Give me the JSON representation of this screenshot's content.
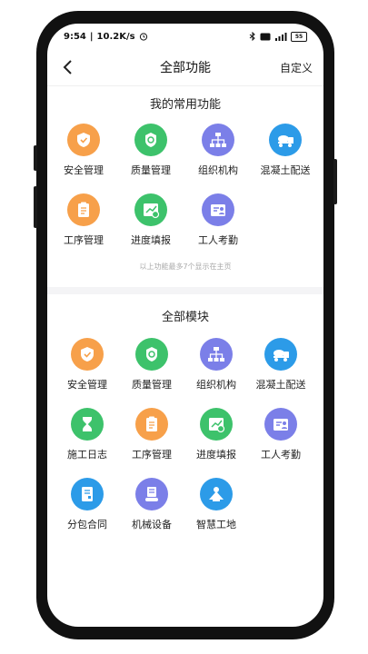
{
  "status_bar": {
    "time": "9:54",
    "speed": "10.2K/s",
    "battery": "55"
  },
  "header": {
    "title": "全部功能",
    "action_label": "自定义"
  },
  "favorites": {
    "title": "我的常用功能",
    "items": [
      {
        "label": "安全管理",
        "icon": "safety-shield-icon",
        "color": "#F7A04A"
      },
      {
        "label": "质量管理",
        "icon": "quality-badge-icon",
        "color": "#3DC26B"
      },
      {
        "label": "组织机构",
        "icon": "org-chart-icon",
        "color": "#7B7FE8"
      },
      {
        "label": "混凝土配送",
        "icon": "concrete-truck-icon",
        "color": "#2C9BE8"
      },
      {
        "label": "工序管理",
        "icon": "process-clipboard-icon",
        "color": "#F7A04A"
      },
      {
        "label": "进度填报",
        "icon": "progress-calendar-icon",
        "color": "#3DC26B"
      },
      {
        "label": "工人考勤",
        "icon": "attendance-icon",
        "color": "#7B7FE8"
      }
    ],
    "hint": "以上功能最多7个显示在主页"
  },
  "all_modules": {
    "title": "全部模块",
    "items": [
      {
        "label": "安全管理",
        "icon": "safety-shield-icon",
        "color": "#F7A04A"
      },
      {
        "label": "质量管理",
        "icon": "quality-badge-icon",
        "color": "#3DC26B"
      },
      {
        "label": "组织机构",
        "icon": "org-chart-icon",
        "color": "#7B7FE8"
      },
      {
        "label": "混凝土配送",
        "icon": "concrete-truck-icon",
        "color": "#2C9BE8"
      },
      {
        "label": "施工日志",
        "icon": "hourglass-icon",
        "color": "#3DC26B"
      },
      {
        "label": "工序管理",
        "icon": "process-clipboard-icon",
        "color": "#F7A04A"
      },
      {
        "label": "进度填报",
        "icon": "progress-calendar-icon",
        "color": "#3DC26B"
      },
      {
        "label": "工人考勤",
        "icon": "attendance-icon",
        "color": "#7B7FE8"
      },
      {
        "label": "分包合同",
        "icon": "contract-icon",
        "color": "#2C9BE8"
      },
      {
        "label": "机械设备",
        "icon": "machinery-icon",
        "color": "#7B7FE8"
      },
      {
        "label": "智慧工地",
        "icon": "smart-site-icon",
        "color": "#2C9BE8"
      }
    ]
  }
}
